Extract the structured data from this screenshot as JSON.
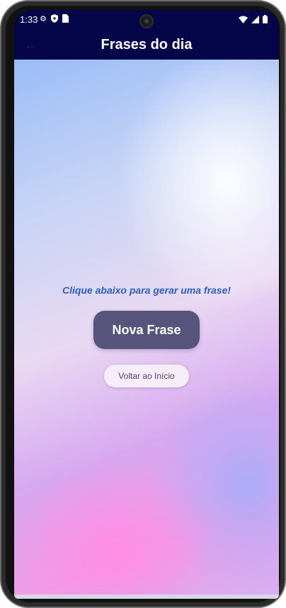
{
  "status_bar": {
    "time": "1:33",
    "icons_left": [
      "gear-icon",
      "shield-icon",
      "sim-icon"
    ],
    "icons_right": [
      "wifi-icon",
      "signal-icon",
      "battery-icon"
    ]
  },
  "app_bar": {
    "title": "Frases do dia",
    "back_icon": "←"
  },
  "main": {
    "prompt": "Clique abaixo para gerar uma frase!",
    "primary_button_label": "Nova Frase",
    "secondary_button_label": "Voltar ao Início"
  },
  "colors": {
    "app_bar": "#050549",
    "prompt_text": "#2f5fb8",
    "primary_button": "#56547a",
    "secondary_button": "#f5eef8"
  }
}
